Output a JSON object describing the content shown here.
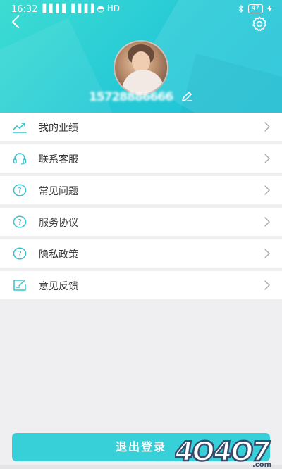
{
  "status_bar": {
    "time": "16:32",
    "signal": "▐▐▐▐ ▐▐▐▐ ◓ HD",
    "battery": "47"
  },
  "header": {
    "phone": "15728886666"
  },
  "menu": {
    "items": [
      {
        "label": "我的业绩",
        "icon": "trend-chart-icon"
      },
      {
        "label": "联系客服",
        "icon": "headset-icon"
      },
      {
        "label": "常见问题",
        "icon": "question-icon"
      },
      {
        "label": "服务协议",
        "icon": "question-icon"
      },
      {
        "label": "隐私政策",
        "icon": "question-icon"
      },
      {
        "label": "意见反馈",
        "icon": "feedback-icon"
      }
    ]
  },
  "logout": {
    "label": "退出登录"
  },
  "watermark": {
    "text": "4O4O7.com"
  },
  "colors": {
    "accent": "#37cfd8",
    "header_start": "#3ddcd2",
    "header_end": "#1fc2d8",
    "icon": "#37c2d0"
  }
}
